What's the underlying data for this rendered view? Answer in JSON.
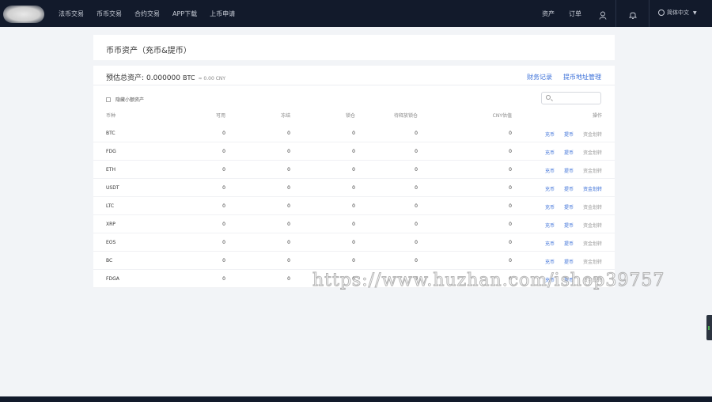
{
  "nav": {
    "left": [
      "法币交易",
      "币币交易",
      "合约交易",
      "APP下载",
      "上币申请"
    ],
    "assets": "资产",
    "orders": "订单",
    "language": "简体中文"
  },
  "page_title": "币币资产（充币&提币）",
  "summary": {
    "label": "预估总资产:",
    "value": "0.000000",
    "unit": "BTC",
    "cny": "≈ 0.00 CNY"
  },
  "links": {
    "records": "财务记录",
    "address": "提币地址管理"
  },
  "hide_small": "隐藏小额资产",
  "search": {
    "placeholder": ""
  },
  "table": {
    "headers": [
      "币种",
      "可用",
      "冻结",
      "锁仓",
      "待释放锁仓",
      "CNY估值",
      "操作"
    ],
    "rows": [
      {
        "coin": "BTC",
        "avail": "0",
        "frozen": "0",
        "lock": "0",
        "unlock": "0",
        "cny": "0",
        "ops": [
          "充币",
          "提币",
          "资金划转"
        ],
        "transfer_active": false
      },
      {
        "coin": "FDG",
        "avail": "0",
        "frozen": "0",
        "lock": "0",
        "unlock": "0",
        "cny": "0",
        "ops": [
          "充币",
          "提币",
          "资金划转"
        ],
        "transfer_active": false
      },
      {
        "coin": "ETH",
        "avail": "0",
        "frozen": "0",
        "lock": "0",
        "unlock": "0",
        "cny": "0",
        "ops": [
          "充币",
          "提币",
          "资金划转"
        ],
        "transfer_active": false
      },
      {
        "coin": "USDT",
        "avail": "0",
        "frozen": "0",
        "lock": "0",
        "unlock": "0",
        "cny": "0",
        "ops": [
          "充币",
          "提币",
          "资金划转"
        ],
        "transfer_active": true
      },
      {
        "coin": "LTC",
        "avail": "0",
        "frozen": "0",
        "lock": "0",
        "unlock": "0",
        "cny": "0",
        "ops": [
          "充币",
          "提币",
          "资金划转"
        ],
        "transfer_active": false
      },
      {
        "coin": "XRP",
        "avail": "0",
        "frozen": "0",
        "lock": "0",
        "unlock": "0",
        "cny": "0",
        "ops": [
          "充币",
          "提币",
          "资金划转"
        ],
        "transfer_active": false
      },
      {
        "coin": "EOS",
        "avail": "0",
        "frozen": "0",
        "lock": "0",
        "unlock": "0",
        "cny": "0",
        "ops": [
          "充币",
          "提币",
          "资金划转"
        ],
        "transfer_active": false
      },
      {
        "coin": "BC",
        "avail": "0",
        "frozen": "0",
        "lock": "0",
        "unlock": "0",
        "cny": "0",
        "ops": [
          "充币",
          "提币",
          "资金划转"
        ],
        "transfer_active": false
      },
      {
        "coin": "FDGA",
        "avail": "0",
        "frozen": "0",
        "lock": "0",
        "unlock": "0",
        "cny": "0",
        "ops": [
          "充币",
          "提币",
          "资金划转"
        ],
        "transfer_active": false
      }
    ]
  },
  "watermark": "https://www.huzhan.com/ishop39757",
  "colors": {
    "nav_bg": "#121a2b",
    "link": "#3a6fd8",
    "page_bg": "#f2f4f7"
  }
}
